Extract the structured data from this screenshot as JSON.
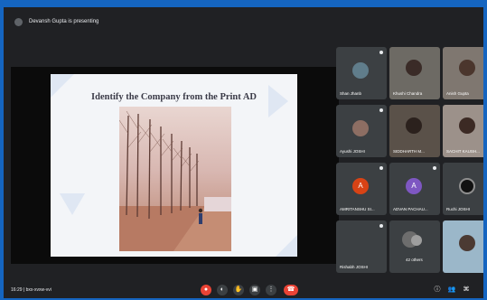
{
  "presenter_bar": {
    "text": "Devansh Gupta is presenting"
  },
  "slide": {
    "title": "Identify the Company from the Print AD"
  },
  "participants": [
    {
      "name": "Shan Jhanb",
      "kind": "avatar"
    },
    {
      "name": "Khushi Chandra",
      "kind": "video"
    },
    {
      "name": "Anish Gupta",
      "kind": "video"
    },
    {
      "name": "Ayushi JOSHI",
      "kind": "avatar"
    },
    {
      "name": "SIDDHARTH M...",
      "kind": "video"
    },
    {
      "name": "SACHIT KAUSH...",
      "kind": "video"
    },
    {
      "name": "AMRITANSHU SI...",
      "kind": "letter",
      "letter": "A",
      "color": "#d84315"
    },
    {
      "name": "ADVAN PACHAU...",
      "kind": "letter",
      "letter": "A",
      "color": "#7e57c2"
    },
    {
      "name": "Ruchi JOSHI",
      "kind": "avatar"
    },
    {
      "name": "Rishabh JOSHI",
      "kind": "blank"
    },
    {
      "name": "42 others",
      "kind": "others"
    },
    {
      "name": "",
      "kind": "video"
    }
  ],
  "bottom_bar": {
    "time_meeting": "16:29  |  bxx-xvxw-vvi"
  },
  "colors": {
    "background": "#1565c0",
    "meet_dark": "#202124",
    "tile": "#3c4043",
    "end_call": "#ea4335"
  }
}
